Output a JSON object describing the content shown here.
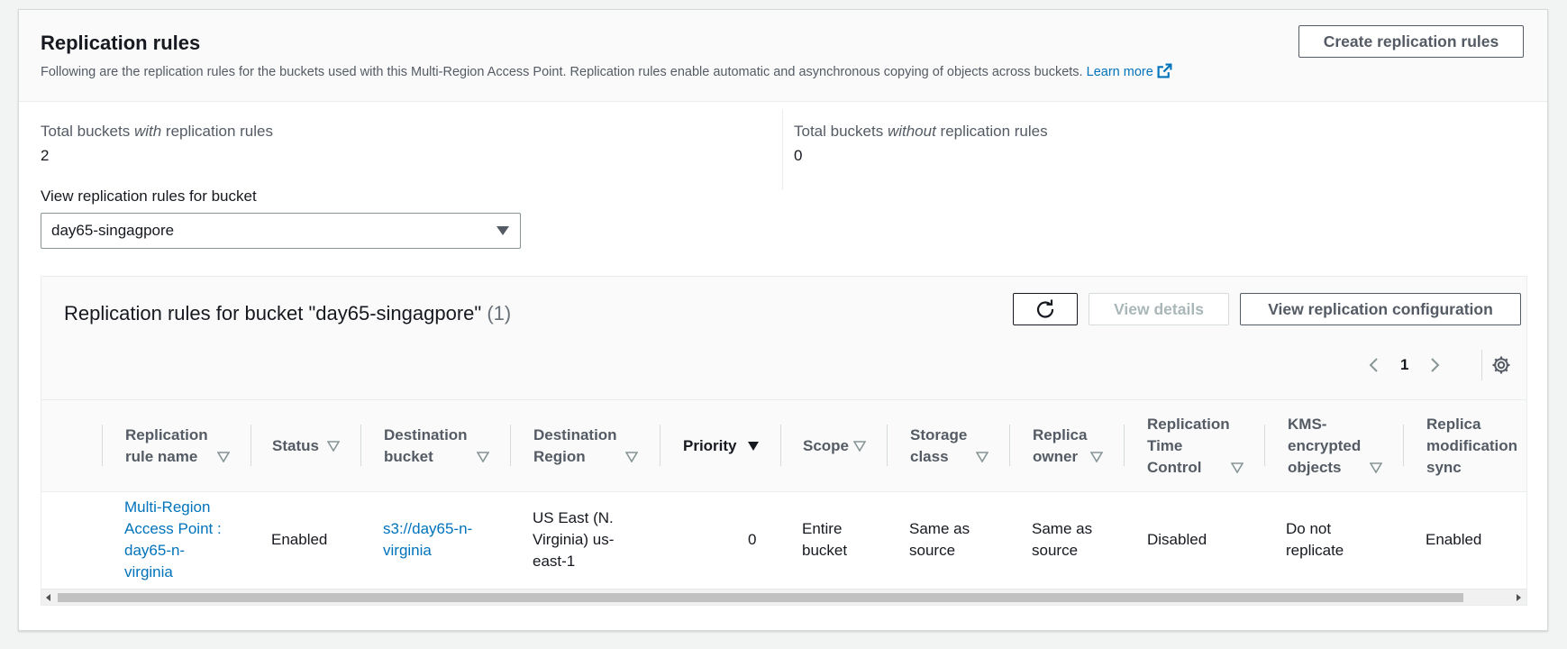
{
  "panel": {
    "title": "Replication rules",
    "description": "Following are the replication rules for the buckets used with this Multi-Region Access Point. Replication rules enable automatic and asynchronous copying of objects across buckets.",
    "learn_more": "Learn more",
    "create_button": "Create replication rules"
  },
  "stats": {
    "with_prefix": "Total buckets ",
    "with_em": "with",
    "with_suffix": " replication rules",
    "with_value": "2",
    "without_prefix": "Total buckets ",
    "without_em": "without",
    "without_suffix": " replication rules",
    "without_value": "0"
  },
  "bucket_select": {
    "label": "View replication rules for bucket",
    "value": "day65-singagpore"
  },
  "table": {
    "title": "Replication rules for bucket \"day65-singagpore\"",
    "count": "(1)",
    "view_details": "View details",
    "view_config": "View replication configuration",
    "page": "1",
    "columns": [
      {
        "l1": "Replication",
        "l2": "rule name",
        "l3": ""
      },
      {
        "l1": "Status",
        "l2": "",
        "l3": ""
      },
      {
        "l1": "Destination",
        "l2": "bucket",
        "l3": ""
      },
      {
        "l1": "Destination",
        "l2": "Region",
        "l3": ""
      },
      {
        "l1": "Priority",
        "l2": "",
        "l3": ""
      },
      {
        "l1": "Scope",
        "l2": "",
        "l3": ""
      },
      {
        "l1": "Storage",
        "l2": "class",
        "l3": ""
      },
      {
        "l1": "Replica",
        "l2": "owner",
        "l3": ""
      },
      {
        "l1": "Replication",
        "l2": "Time",
        "l3": "Control"
      },
      {
        "l1": "KMS-",
        "l2": "encrypted",
        "l3": "objects"
      },
      {
        "l1": "Replica",
        "l2": "modification",
        "l3": "sync"
      }
    ],
    "row": {
      "rule_name": [
        "Multi-Region",
        "Access Point :",
        "day65-n-",
        "virginia"
      ],
      "status": "Enabled",
      "destination_bucket": [
        "s3://day65-n-",
        "virginia"
      ],
      "destination_region": [
        "US East (N.",
        "Virginia) us-",
        "east-1"
      ],
      "priority": "0",
      "scope": [
        "Entire",
        "bucket"
      ],
      "storage_class": [
        "Same as",
        "source"
      ],
      "replica_owner": [
        "Same as",
        "source"
      ],
      "rtc": "Disabled",
      "kms": [
        "Do not",
        "replicate"
      ],
      "mod_sync": "Enabled"
    }
  },
  "colors": {
    "link": "#0073bb",
    "text": "#16191f",
    "muted": "#545b64"
  }
}
